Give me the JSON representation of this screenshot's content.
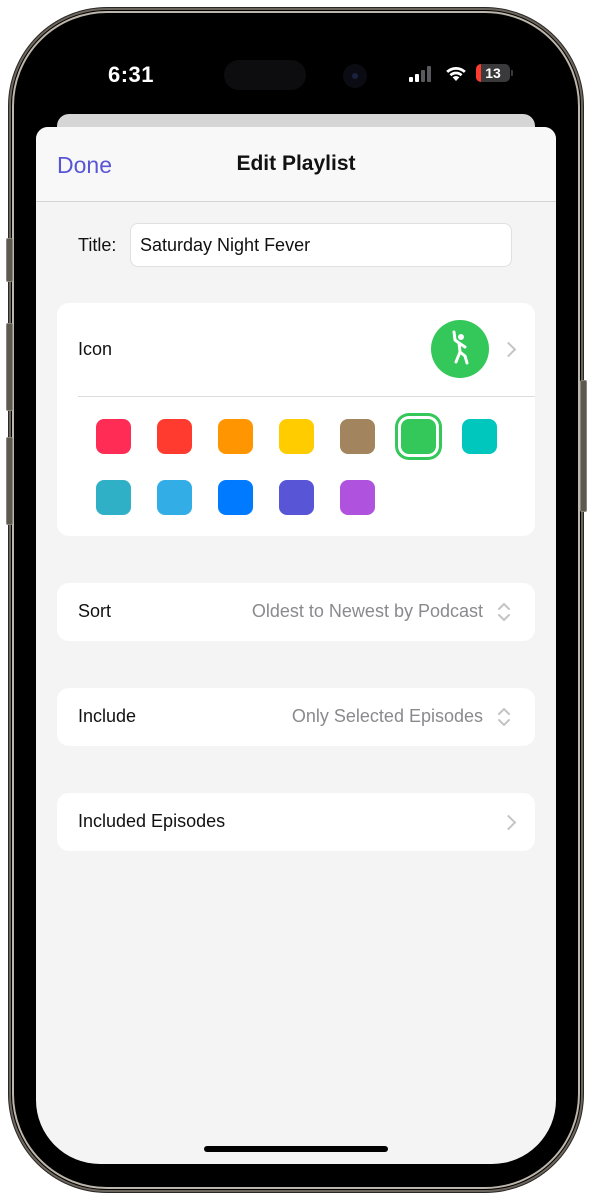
{
  "status_bar": {
    "time": "6:31",
    "battery_level": "13",
    "signal_bars_filled": 2,
    "signal_bars_total": 4
  },
  "nav": {
    "done_label": "Done",
    "title": "Edit Playlist"
  },
  "form": {
    "title_label": "Title:",
    "title_value": "Saturday Night Fever",
    "icon_label": "Icon",
    "icon_glyph": "dancing-figure-icon",
    "icon_color": "#34c759",
    "colors": [
      {
        "hex": "#ff2d55",
        "selected": false
      },
      {
        "hex": "#ff3b30",
        "selected": false
      },
      {
        "hex": "#ff9500",
        "selected": false
      },
      {
        "hex": "#ffcc00",
        "selected": false
      },
      {
        "hex": "#a2845e",
        "selected": false
      },
      {
        "hex": "#34c759",
        "selected": true
      },
      {
        "hex": "#00c7be",
        "selected": false
      },
      {
        "hex": "#30b0c7",
        "selected": false
      },
      {
        "hex": "#32ade6",
        "selected": false
      },
      {
        "hex": "#007aff",
        "selected": false
      },
      {
        "hex": "#5856d6",
        "selected": false
      },
      {
        "hex": "#af52de",
        "selected": false
      }
    ],
    "sort_label": "Sort",
    "sort_value": "Oldest to Newest by Podcast",
    "include_label": "Include",
    "include_value": "Only Selected Episodes",
    "included_episodes_label": "Included Episodes"
  },
  "colors": {
    "accent": "#5956d6",
    "background": "#f4f4f4"
  }
}
